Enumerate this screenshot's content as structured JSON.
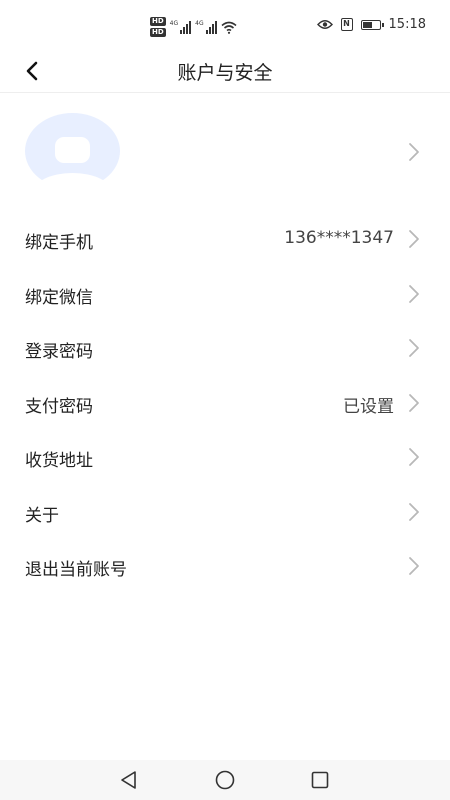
{
  "status_bar": {
    "network_labels": [
      "4G",
      "4G"
    ],
    "hd_labels": [
      "HD",
      "HD"
    ],
    "time": "15:18",
    "battery_level": 0.6,
    "icons": [
      "hd-icon",
      "signal-icon",
      "wifi-icon",
      "eye-icon",
      "nfc-icon",
      "battery-icon"
    ]
  },
  "header": {
    "title": "账户与安全",
    "back_icon": "chevron-left-icon"
  },
  "avatar_row": {
    "avatar_color": "#e8efff",
    "chevron_icon": "chevron-right-icon"
  },
  "settings": [
    {
      "label": "绑定手机",
      "value": "136****1347"
    },
    {
      "label": "绑定微信",
      "value": ""
    },
    {
      "label": "登录密码",
      "value": ""
    },
    {
      "label": "支付密码",
      "value": "已设置"
    },
    {
      "label": "收货地址",
      "value": ""
    },
    {
      "label": "关于",
      "value": ""
    },
    {
      "label": "退出当前账号",
      "value": ""
    }
  ],
  "nav_bar": {
    "icons": [
      "back-triangle-icon",
      "home-circle-icon",
      "recents-square-icon"
    ]
  },
  "colors": {
    "text": "#222222",
    "chevron": "#b8b8b8",
    "divider": "#eeeeee",
    "avatar_bg": "#e8efff"
  }
}
